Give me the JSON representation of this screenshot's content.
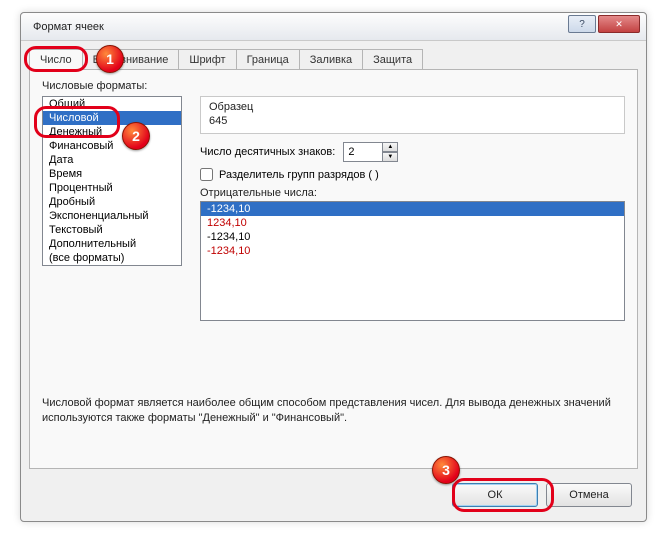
{
  "window": {
    "title": "Формат ячеек"
  },
  "tabs": [
    "Число",
    "Выравнивание",
    "Шрифт",
    "Граница",
    "Заливка",
    "Защита"
  ],
  "active_tab": 0,
  "labels": {
    "formats": "Числовые форматы:",
    "sample": "Образец",
    "decimals": "Число десятичных знаков:",
    "separator": "Разделитель групп разрядов ( )",
    "negatives": "Отрицательные числа:"
  },
  "format_list": [
    "Общий",
    "Числовой",
    "Денежный",
    "Финансовый",
    "Дата",
    "Время",
    "Процентный",
    "Дробный",
    "Экспоненциальный",
    "Текстовый",
    "Дополнительный",
    "(все форматы)"
  ],
  "selected_format_index": 1,
  "sample_value": "645",
  "decimals_value": "2",
  "separator_checked": false,
  "negatives": [
    {
      "text": "-1234,10",
      "red": false,
      "selected": true
    },
    {
      "text": "1234,10",
      "red": true,
      "selected": false
    },
    {
      "text": "-1234,10",
      "red": false,
      "selected": false
    },
    {
      "text": "-1234,10",
      "red": true,
      "selected": false
    }
  ],
  "description": "Числовой формат является наиболее общим способом представления чисел. Для вывода денежных значений используются также форматы \"Денежный\" и \"Финансовый\".",
  "buttons": {
    "ok": "ОК",
    "cancel": "Отмена"
  },
  "annotations": {
    "b1": "1",
    "b2": "2",
    "b3": "3"
  }
}
